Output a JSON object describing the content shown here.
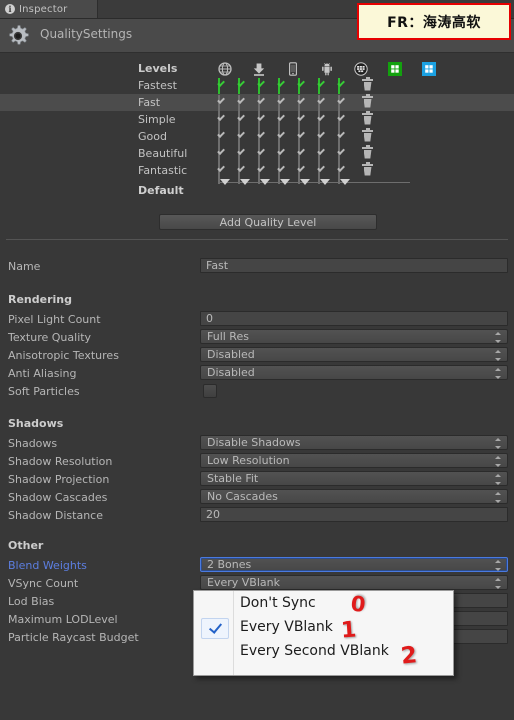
{
  "tab": {
    "label": "Inspector",
    "icon": "info-icon"
  },
  "header": {
    "title": "QualitySettings",
    "icon": "gear-icon"
  },
  "watermark": {
    "text": "FR：海涛高软"
  },
  "levels": {
    "header_label": "Levels",
    "platforms": [
      {
        "name": "web-player-icon",
        "title": "Web Player"
      },
      {
        "name": "standalone-icon",
        "title": "Standalone"
      },
      {
        "name": "ios-icon",
        "title": "iOS"
      },
      {
        "name": "android-icon",
        "title": "Android"
      },
      {
        "name": "blackberry-icon",
        "title": "BlackBerry"
      },
      {
        "name": "windows-store-icon",
        "title": "Windows Store Apps"
      },
      {
        "name": "windows-phone-icon",
        "title": "Windows Phone 8"
      }
    ],
    "rows": [
      {
        "name": "Fastest",
        "selected": false,
        "green": true,
        "checks": [
          true,
          true,
          true,
          true,
          true,
          true,
          true
        ]
      },
      {
        "name": "Fast",
        "selected": true,
        "green": false,
        "checks": [
          true,
          true,
          true,
          true,
          true,
          true,
          true
        ]
      },
      {
        "name": "Simple",
        "selected": false,
        "green": false,
        "checks": [
          true,
          true,
          true,
          true,
          true,
          true,
          true
        ]
      },
      {
        "name": "Good",
        "selected": false,
        "green": false,
        "checks": [
          true,
          true,
          true,
          true,
          true,
          true,
          true
        ]
      },
      {
        "name": "Beautiful",
        "selected": false,
        "green": false,
        "checks": [
          true,
          true,
          true,
          true,
          true,
          true,
          true
        ]
      },
      {
        "name": "Fantastic",
        "selected": false,
        "green": false,
        "checks": [
          true,
          true,
          true,
          true,
          true,
          true,
          true
        ]
      }
    ],
    "default_label": "Default",
    "default_markers": 7
  },
  "add_button": {
    "label": "Add Quality Level"
  },
  "name_row": {
    "label": "Name",
    "value": "Fast"
  },
  "sections": {
    "rendering": "Rendering",
    "shadows": "Shadows",
    "other": "Other"
  },
  "rendering": [
    {
      "label": "Pixel Light Count",
      "value": "0",
      "type": "text"
    },
    {
      "label": "Texture Quality",
      "value": "Full Res",
      "type": "popup"
    },
    {
      "label": "Anisotropic Textures",
      "value": "Disabled",
      "type": "popup"
    },
    {
      "label": "Anti Aliasing",
      "value": "Disabled",
      "type": "popup"
    },
    {
      "label": "Soft Particles",
      "value": "",
      "type": "checkbox"
    }
  ],
  "shadows": [
    {
      "label": "Shadows",
      "value": "Disable Shadows",
      "type": "popup"
    },
    {
      "label": "Shadow Resolution",
      "value": "Low Resolution",
      "type": "popup"
    },
    {
      "label": "Shadow Projection",
      "value": "Stable Fit",
      "type": "popup"
    },
    {
      "label": "Shadow Cascades",
      "value": "No Cascades",
      "type": "popup"
    },
    {
      "label": "Shadow Distance",
      "value": "20",
      "type": "text"
    }
  ],
  "other": [
    {
      "label": "Blend Weights",
      "value": "2 Bones",
      "type": "popup",
      "focused": true
    },
    {
      "label": "VSync Count",
      "value": "Every VBlank",
      "type": "popup",
      "focused": false
    },
    {
      "label": "Lod Bias",
      "value": "",
      "type": "text",
      "focused": false
    },
    {
      "label": "Maximum LODLevel",
      "value": "",
      "type": "text",
      "focused": false
    },
    {
      "label": "Particle Raycast Budget",
      "value": "",
      "type": "text",
      "focused": false
    }
  ],
  "dropdown": {
    "open_for": "VSync Count",
    "selected_index": 1,
    "options": [
      {
        "label": "Don't Sync",
        "annotation": "0"
      },
      {
        "label": "Every VBlank",
        "annotation": "1"
      },
      {
        "label": "Every Second VBlank",
        "annotation": "2"
      }
    ]
  },
  "colors": {
    "background": "#383838",
    "panel": "#4a4a4a",
    "selected_row": "#4c4c4c",
    "label": "#b6b6b6",
    "focus_blue": "#5c7ee0",
    "check_green": "#36cc36",
    "annotation_red": "#e01b1b",
    "watermark_bg": "#fbf8d8",
    "watermark_border": "#e60000"
  }
}
